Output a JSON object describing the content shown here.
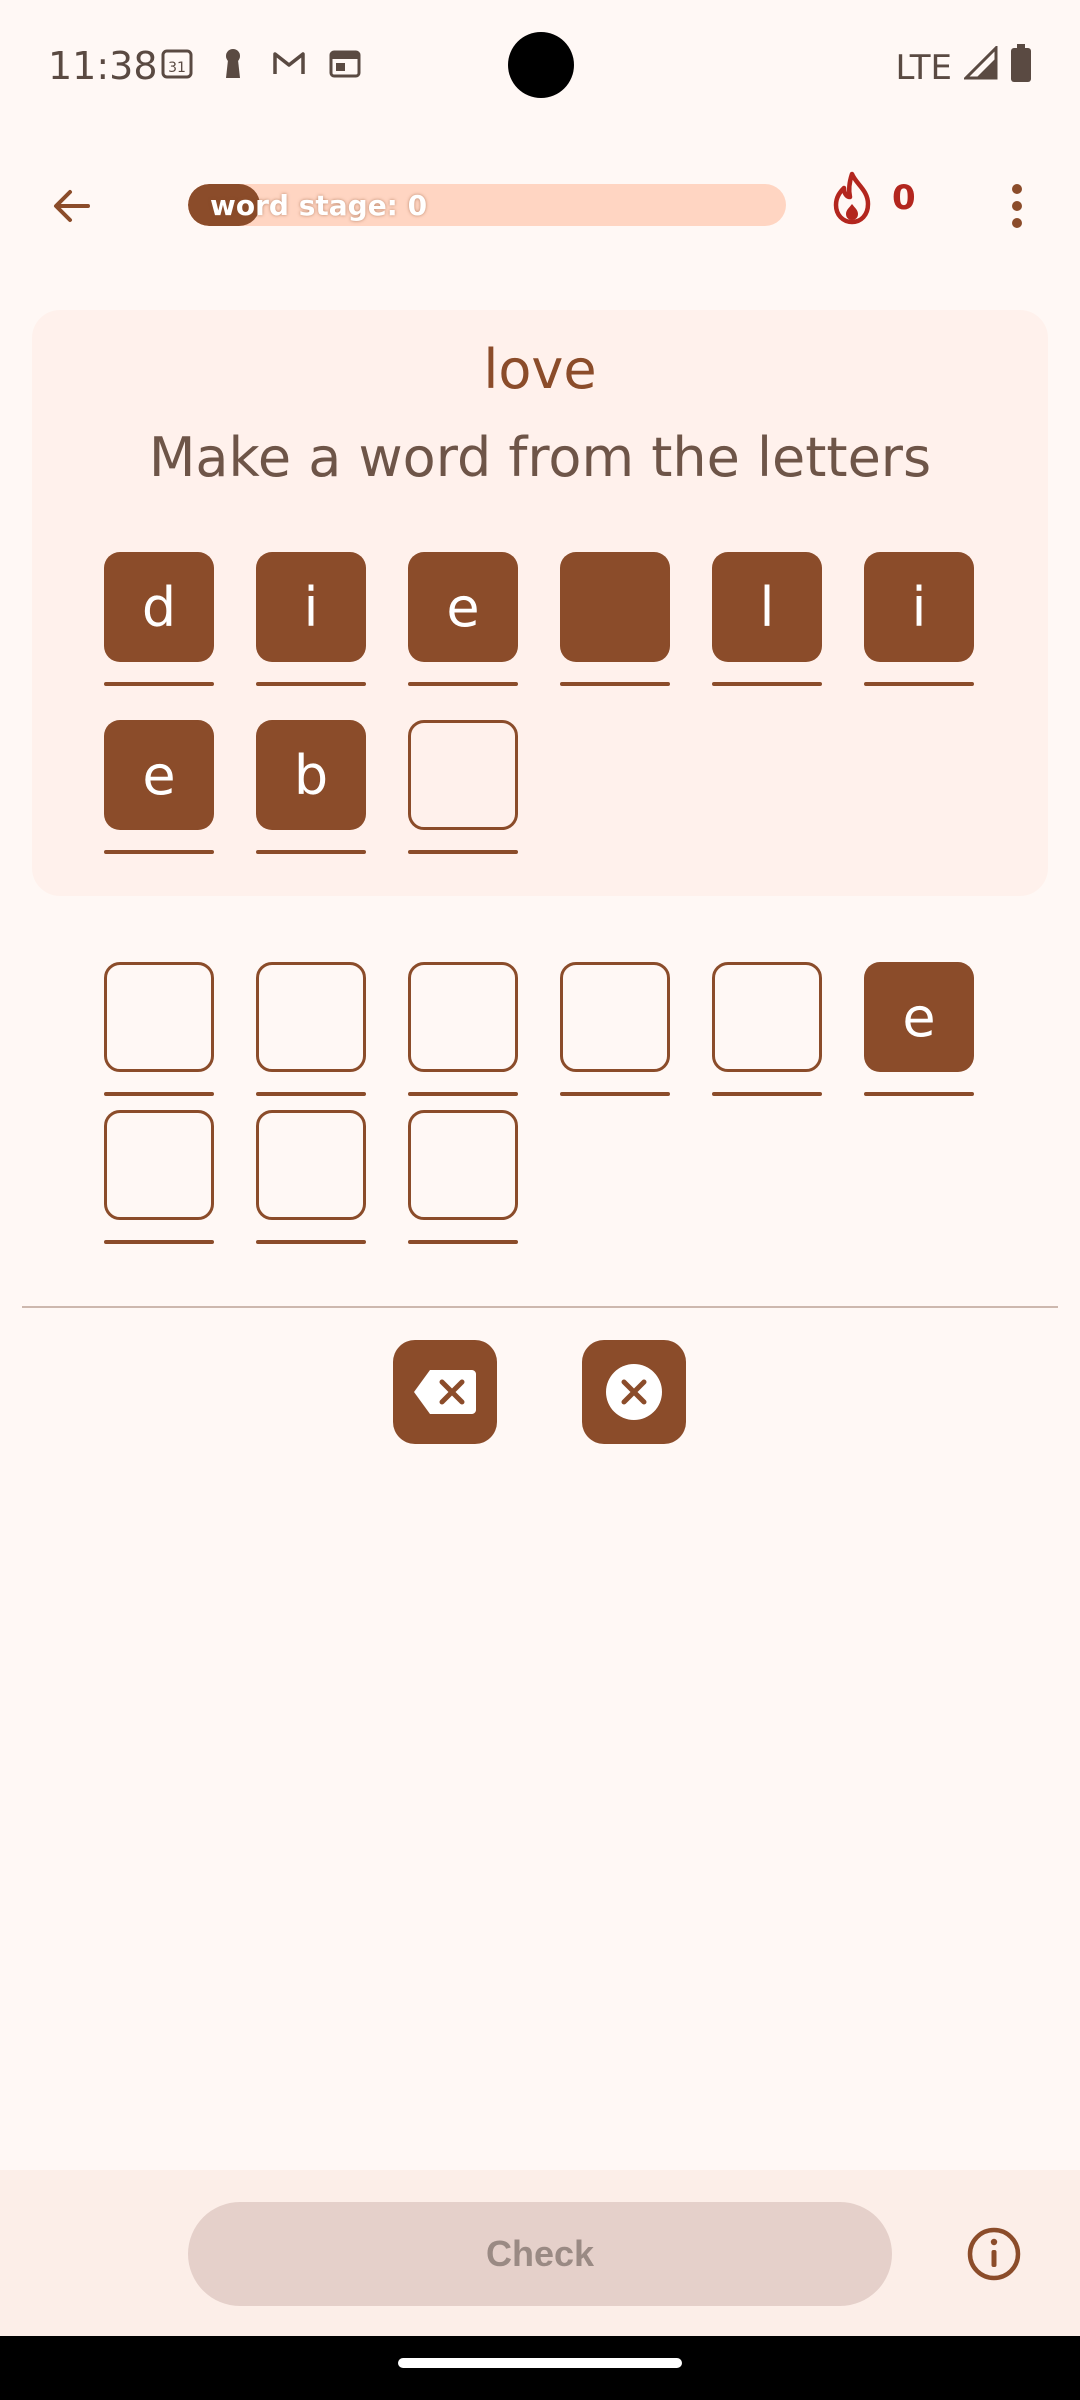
{
  "status_bar": {
    "time": "11:38",
    "network": "LTE",
    "notification_icons": [
      "calendar-icon",
      "keyhole-icon",
      "gmail-icon",
      "news-icon"
    ]
  },
  "app_bar": {
    "progress_label": "word stage: 0",
    "progress_fraction": 0.12,
    "streak_count": "0"
  },
  "card": {
    "target_word": "love",
    "instruction": "Make a word from the letters",
    "letters": [
      {
        "char": "d",
        "filled": true
      },
      {
        "char": "i",
        "filled": true
      },
      {
        "char": "e",
        "filled": true
      },
      {
        "char": "",
        "filled": true
      },
      {
        "char": "l",
        "filled": true
      },
      {
        "char": "i",
        "filled": true
      },
      {
        "char": "e",
        "filled": true
      },
      {
        "char": "b",
        "filled": true
      },
      {
        "char": "",
        "filled": false
      }
    ]
  },
  "answer": {
    "slots": [
      {
        "char": "",
        "filled": false
      },
      {
        "char": "",
        "filled": false
      },
      {
        "char": "",
        "filled": false
      },
      {
        "char": "",
        "filled": false
      },
      {
        "char": "",
        "filled": false
      },
      {
        "char": "e",
        "filled": true
      },
      {
        "char": "",
        "filled": false
      },
      {
        "char": "",
        "filled": false
      },
      {
        "char": "",
        "filled": false
      }
    ]
  },
  "controls": {
    "backspace_icon": "backspace-icon",
    "clear_icon": "clear-circle-icon"
  },
  "bottom_bar": {
    "check_label": "Check"
  },
  "colors": {
    "accent": "#8B4C2A",
    "background": "#FFF8F5",
    "card": "#FFF1EC",
    "streak": "#B3261E"
  }
}
